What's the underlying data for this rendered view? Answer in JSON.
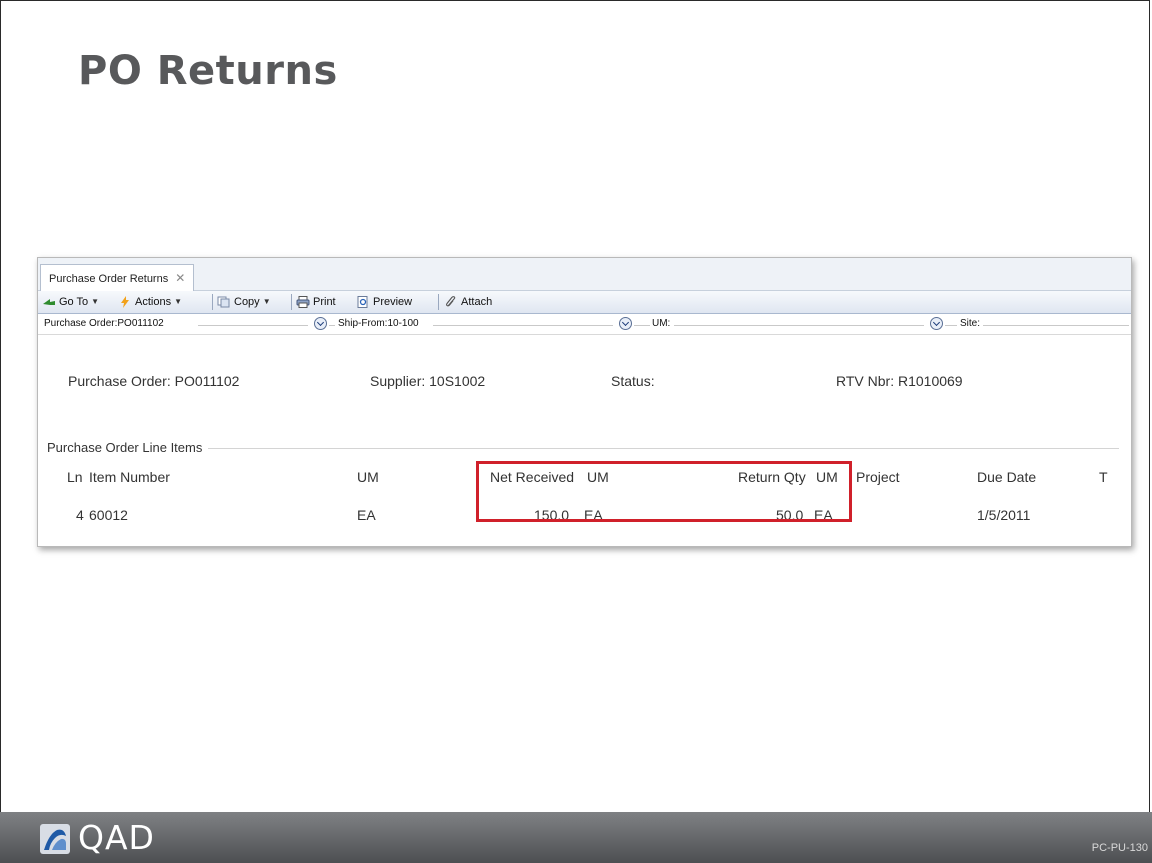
{
  "slide": {
    "title": "PO Returns",
    "code": "PC-PU-130"
  },
  "tab": {
    "label": "Purchase Order Returns",
    "close": "✕"
  },
  "toolbar": {
    "goto": "Go To",
    "actions": "Actions",
    "copy": "Copy",
    "print": "Print",
    "preview": "Preview",
    "attach": "Attach"
  },
  "filters": {
    "purchase_order": "Purchase Order:PO011102",
    "ship_from": "Ship-From:10-100",
    "um": "UM:",
    "site": "Site:"
  },
  "info": {
    "purchase_order": "Purchase Order:  PO011102",
    "supplier": "Supplier:  10S1002",
    "status": "Status:",
    "rtv": "RTV Nbr:  R1010069"
  },
  "section": {
    "title": "Purchase Order Line Items"
  },
  "table": {
    "headers": {
      "ln": "Ln",
      "item_number": "Item Number",
      "um": "UM",
      "net_received": "Net Received",
      "net_um": "UM",
      "return_qty": "Return Qty",
      "return_um": "UM",
      "project": "Project",
      "due_date": "Due Date",
      "t": "T"
    },
    "rows": [
      {
        "ln": "4",
        "item_number": "60012",
        "um": "EA",
        "net_received": "150.0",
        "net_um": "EA",
        "return_qty": "50.0",
        "return_um": "EA",
        "project": "",
        "due_date": "1/5/2011"
      }
    ]
  },
  "footer": {
    "logo_text": "QAD"
  },
  "colors": {
    "highlight": "#d0202a",
    "footer": "#5d5f62",
    "title": "#58595b"
  }
}
